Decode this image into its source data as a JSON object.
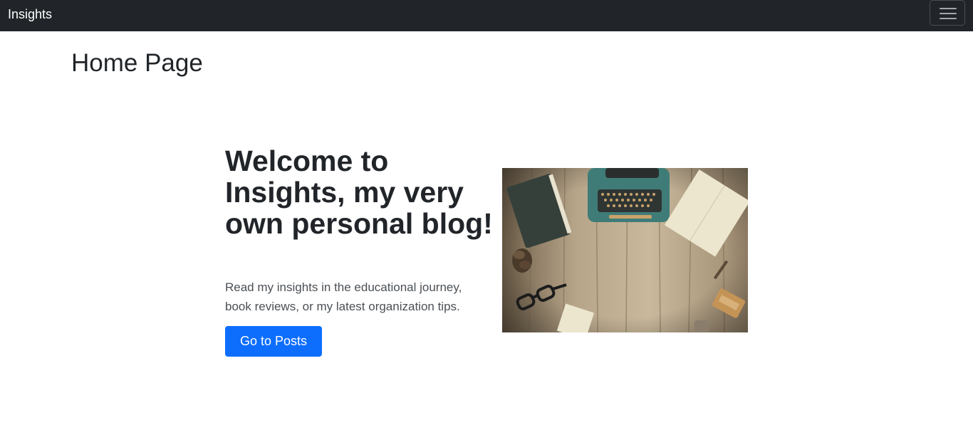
{
  "navbar": {
    "brand": "Insights",
    "toggle_icon": "hamburger-menu-icon",
    "background": "#212529"
  },
  "page": {
    "title": "Home Page"
  },
  "hero": {
    "heading": "Welcome to Insights, my very own personal blog!",
    "lead": "Read my insights in the educational journey, book reviews, or my latest organization tips.",
    "button_label": "Go to Posts",
    "button_color": "#0d6efd",
    "image_subject": "typewriter, notebook, glasses and pine cone on a wooden desk"
  }
}
